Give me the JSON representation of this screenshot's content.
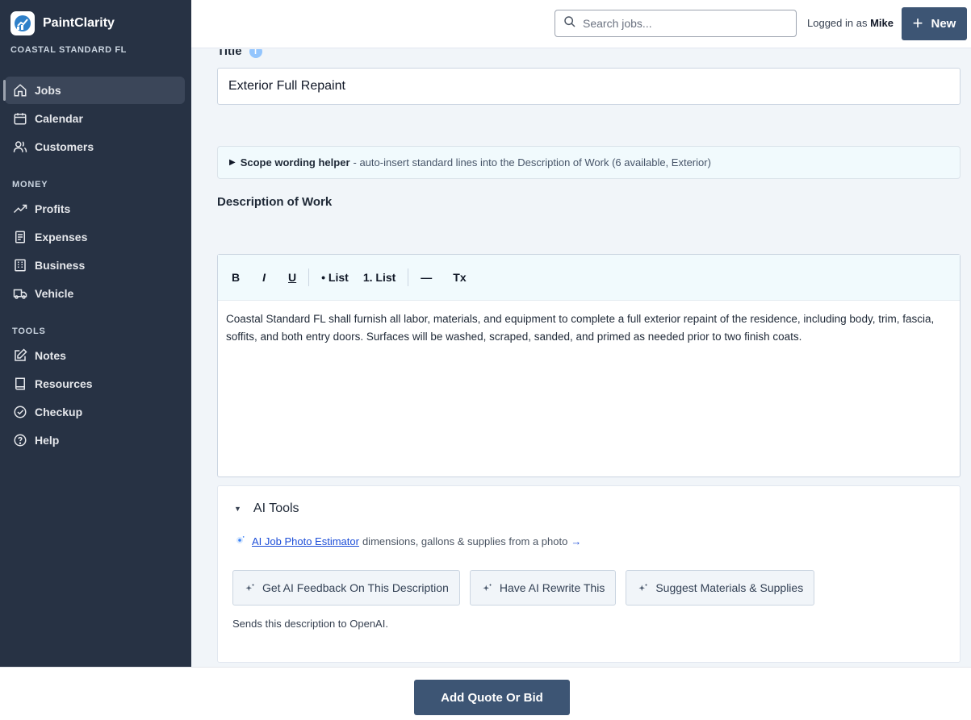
{
  "brand": {
    "name": "PaintClarity",
    "org": "COASTAL STANDARD FL"
  },
  "sidebar": {
    "main_items": [
      {
        "label": "Jobs",
        "icon": "home-icon",
        "active": true
      },
      {
        "label": "Calendar",
        "icon": "calendar-icon"
      },
      {
        "label": "Customers",
        "icon": "users-icon"
      }
    ],
    "money_heading": "MONEY",
    "money_items": [
      {
        "label": "Profits",
        "icon": "trending-up-icon"
      },
      {
        "label": "Expenses",
        "icon": "receipt-icon"
      },
      {
        "label": "Business",
        "icon": "building-icon"
      },
      {
        "label": "Vehicle",
        "icon": "truck-icon"
      }
    ],
    "tools_heading": "TOOLS",
    "tools_items": [
      {
        "label": "Notes",
        "icon": "edit-icon"
      },
      {
        "label": "Resources",
        "icon": "book-icon"
      },
      {
        "label": "Checkup",
        "icon": "check-circle-icon"
      },
      {
        "label": "Help",
        "icon": "help-circle-icon"
      }
    ]
  },
  "header": {
    "search_placeholder": "Search jobs...",
    "logged_prefix": "Logged in as",
    "user": "Mike",
    "new_label": "New"
  },
  "form": {
    "title_label": "Title",
    "title_value": "Exterior Full Repaint",
    "helper_title": "Scope wording helper",
    "helper_text": "- auto-insert standard lines into the Description of Work (6 available, Exterior)",
    "description_label": "Description of Work",
    "toolbar": {
      "bold": "B",
      "italic": "I",
      "underline": "U",
      "bullet_list": "• List",
      "numbered_list": "1. List",
      "rule": "—",
      "clear": "Tx"
    },
    "description_text": "Coastal Standard FL shall furnish all labor, materials, and equipment to complete a full exterior repaint of the residence, including body, trim, fascia, soffits, and both entry doors. Surfaces will be washed, scraped, sanded, and primed as needed prior to two finish coats."
  },
  "ai_tools": {
    "heading": "AI Tools",
    "photo_link": "AI Job Photo Estimator",
    "photo_text": "dimensions, gallons & supplies from a photo",
    "photo_arrow": "→",
    "buttons": [
      "Get AI Feedback On This Description",
      "Have AI Rewrite This",
      "Suggest Materials & Supplies"
    ],
    "note": "Sends this description to OpenAI."
  },
  "footer": {
    "add_quote_label": "Add Quote Or Bid"
  },
  "colors": {
    "sidebar_bg": "#273244",
    "primary": "#3d5574",
    "link": "#1d4ed8"
  }
}
